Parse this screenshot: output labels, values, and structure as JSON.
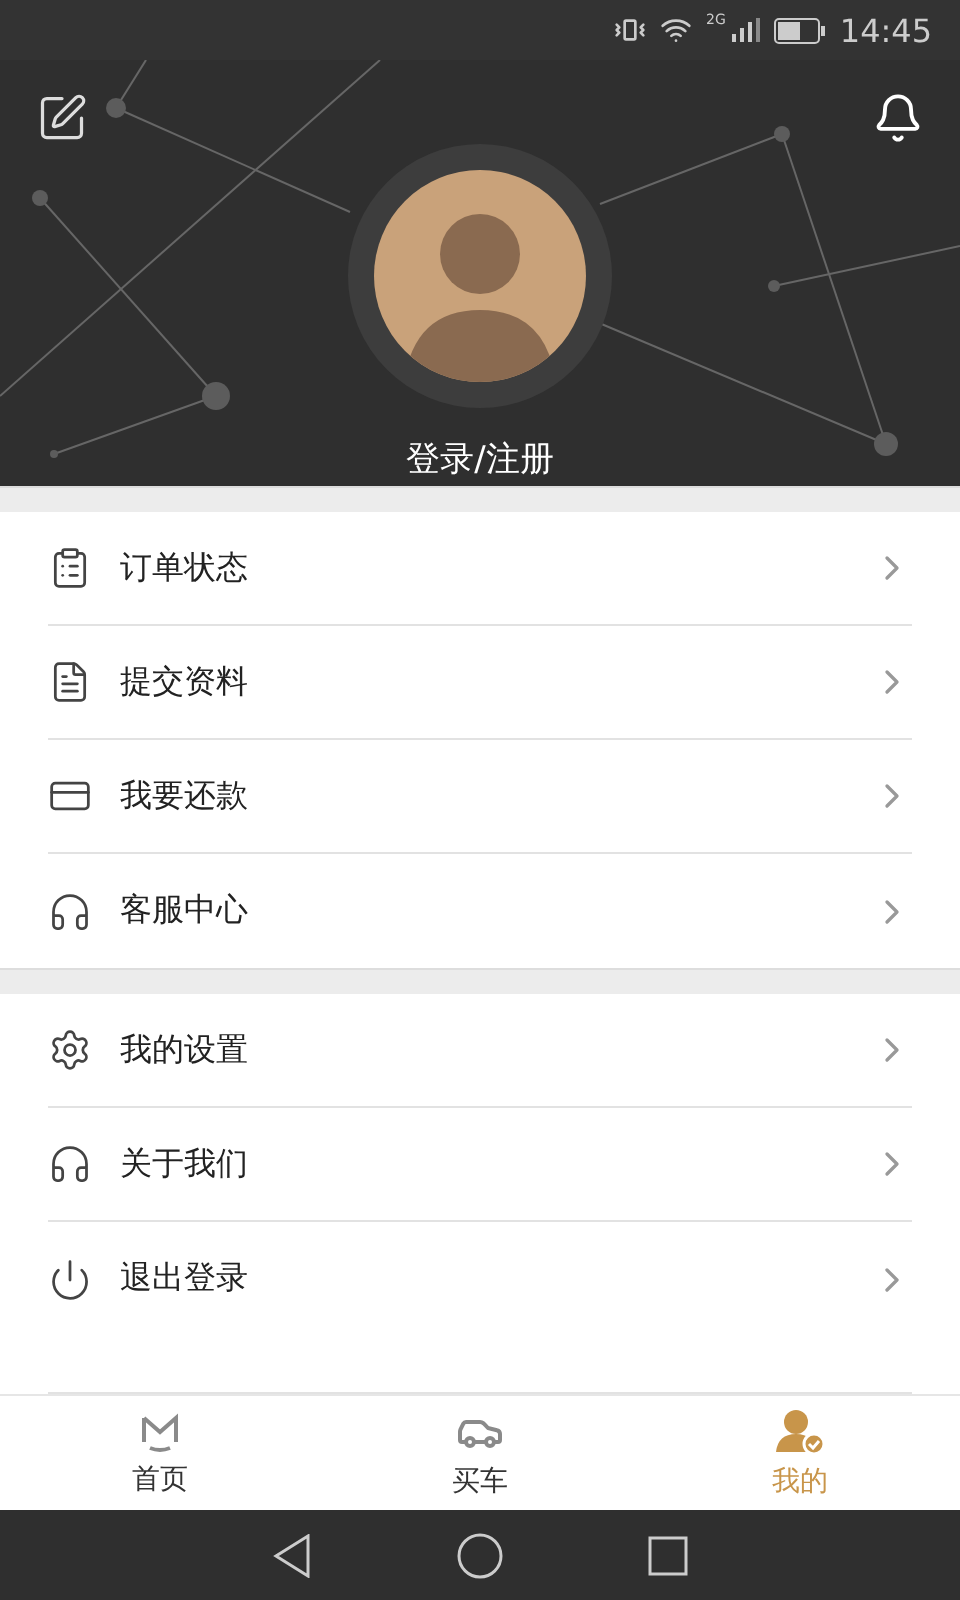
{
  "status_bar": {
    "time": "14:45",
    "network": "2G"
  },
  "profile": {
    "login_label": "登录/注册"
  },
  "menu_groups": [
    {
      "items": [
        {
          "label": "订单状态",
          "kind": "order"
        },
        {
          "label": "提交资料",
          "kind": "document"
        },
        {
          "label": "我要还款",
          "kind": "repay"
        },
        {
          "label": "客服中心",
          "kind": "service"
        }
      ]
    },
    {
      "items": [
        {
          "label": "我的设置",
          "kind": "settings"
        },
        {
          "label": "关于我们",
          "kind": "service"
        },
        {
          "label": "退出登录",
          "kind": "logout"
        }
      ]
    }
  ],
  "tabs": [
    {
      "label": "首页",
      "kind": "home",
      "selected": false
    },
    {
      "label": "买车",
      "kind": "car",
      "selected": false
    },
    {
      "label": "我的",
      "kind": "me",
      "selected": true
    }
  ]
}
